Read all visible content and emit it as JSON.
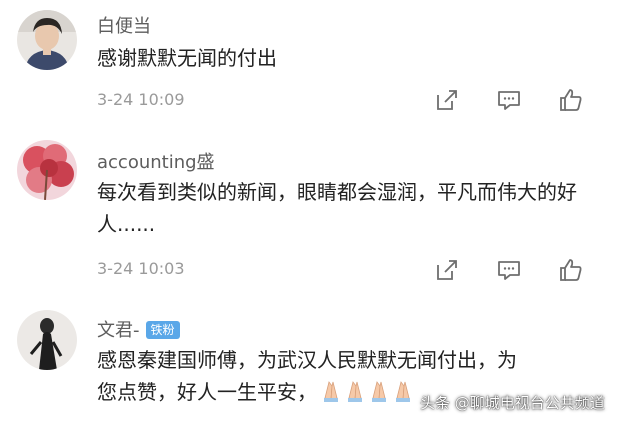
{
  "comments": [
    {
      "username": "白便当",
      "text": "感谢默默无闻的付出",
      "time": "3-24 10:09"
    },
    {
      "username": "accounting盛",
      "text": "每次看到类似的新闻，眼睛都会湿润，平凡而伟大的好人......",
      "time": "3-24 10:03"
    },
    {
      "username": "文君-",
      "badge": "铁粉",
      "text_line1": "感恩秦建国师傅，为武汉人民默默无闻付出，为",
      "text_line2": "您点赞，好人一生平安，"
    }
  ],
  "watermark": "头条 @聊城电视台公共频道",
  "icons": [
    "share-icon",
    "comment-icon",
    "like-icon",
    "praying-hands-icon"
  ]
}
